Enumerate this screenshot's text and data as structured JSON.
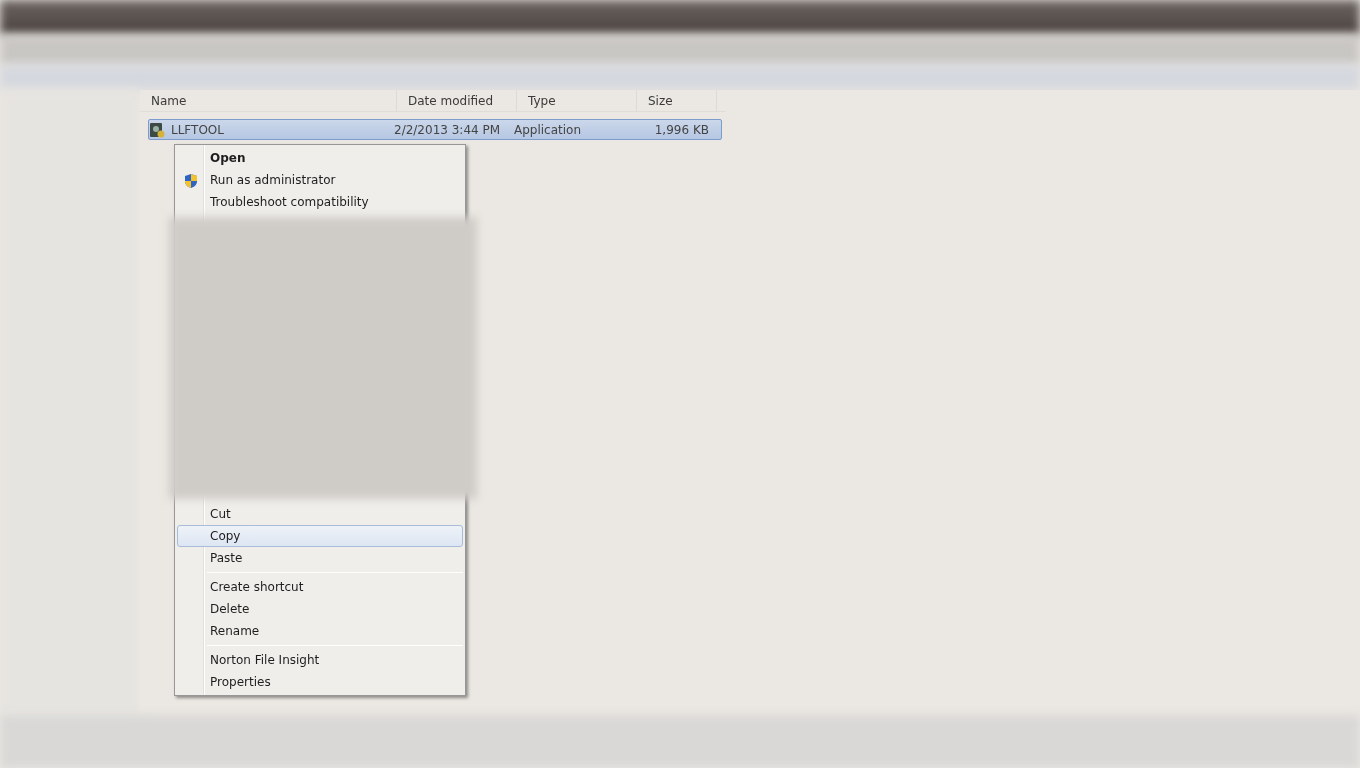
{
  "file_list": {
    "columns": [
      "Name",
      "Date modified",
      "Type",
      "Size"
    ],
    "rows": [
      {
        "name": "LLFTOOL",
        "date": "2/2/2013 3:44 PM",
        "type": "Application",
        "size": "1,996 KB",
        "selected": true
      }
    ]
  },
  "context_menu": {
    "items": [
      {
        "kind": "item",
        "label": "Open",
        "default": true,
        "selected": false
      },
      {
        "kind": "shield_item",
        "label": "Run as administrator",
        "default": false,
        "selected": false
      },
      {
        "kind": "item",
        "label": "Troubleshoot compatibility",
        "default": false,
        "selected": false
      },
      {
        "kind": "blurred"
      },
      {
        "kind": "item",
        "label": "Cut",
        "default": false,
        "selected": false
      },
      {
        "kind": "item",
        "label": "Copy",
        "default": false,
        "selected": true
      },
      {
        "kind": "item",
        "label": "Paste",
        "default": false,
        "selected": false
      },
      {
        "kind": "separator"
      },
      {
        "kind": "item",
        "label": "Create shortcut",
        "default": false,
        "selected": false
      },
      {
        "kind": "item",
        "label": "Delete",
        "default": false,
        "selected": false
      },
      {
        "kind": "item",
        "label": "Rename",
        "default": false,
        "selected": false
      },
      {
        "kind": "separator"
      },
      {
        "kind": "item",
        "label": "Norton File Insight",
        "default": false,
        "selected": false
      },
      {
        "kind": "item",
        "label": "Properties",
        "default": false,
        "selected": false
      }
    ]
  }
}
